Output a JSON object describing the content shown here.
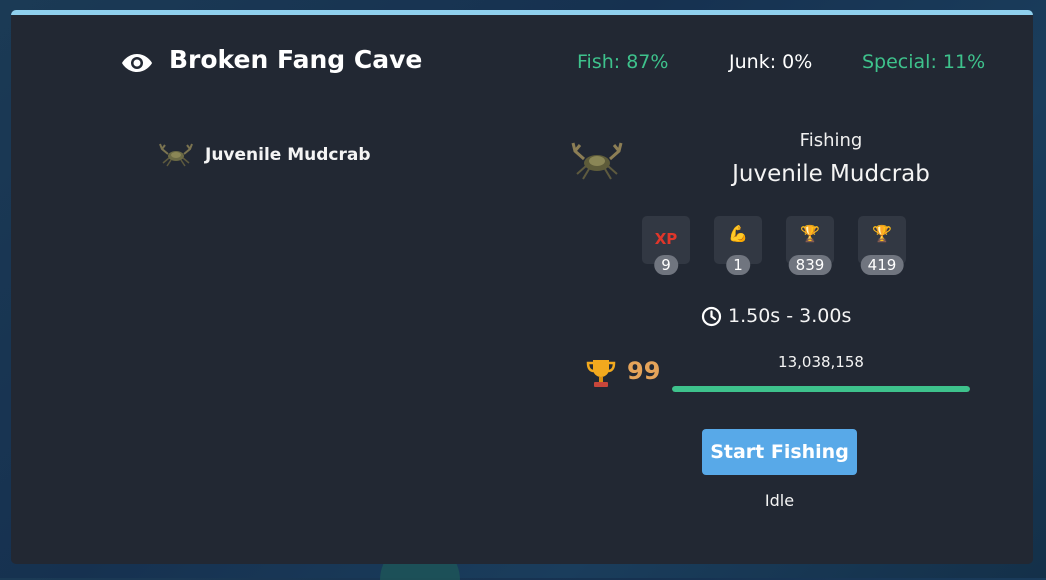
{
  "location": {
    "title": "Broken Fang Cave",
    "stats": {
      "fish": "Fish: 87%",
      "junk": "Junk: 0%",
      "special": "Special: 11%"
    }
  },
  "loot_list": [
    {
      "name": "Juvenile Mudcrab",
      "icon": "crab-icon"
    }
  ],
  "action": {
    "activity": "Fishing",
    "target": "Juvenile Mudcrab",
    "badges": [
      {
        "icon": "xp-icon",
        "glyph": "XP",
        "count": "9"
      },
      {
        "icon": "strength-icon",
        "glyph": "💪",
        "count": "1"
      },
      {
        "icon": "mastery-trophy-icon",
        "glyph": "🏆",
        "count": "839"
      },
      {
        "icon": "pool-trophy-icon",
        "glyph": "🏆",
        "count": "419"
      }
    ],
    "duration": "1.50s - 3.00s",
    "mastery": {
      "level": "99",
      "xp": "13,038,158",
      "progress": 1.0
    },
    "button_label": "Start Fishing",
    "status": "Idle"
  },
  "colors": {
    "accent_green": "#3ec28c",
    "button_blue": "#58a9e8",
    "mastery_gold": "#e5a45a",
    "panel_bg": "#222833"
  }
}
